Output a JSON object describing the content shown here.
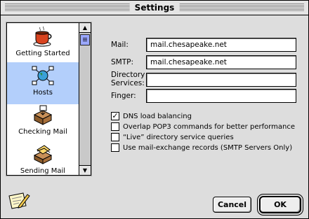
{
  "window": {
    "title": "Settings"
  },
  "sidebar": {
    "items": [
      {
        "label": "Getting Started",
        "icon": "coffee-cup-icon",
        "selected": false
      },
      {
        "label": "Hosts",
        "icon": "network-globe-icon",
        "selected": true
      },
      {
        "label": "Checking Mail",
        "icon": "mailbox-tray-icon",
        "selected": false
      },
      {
        "label": "Sending Mail",
        "icon": "outbox-letters-icon",
        "selected": false
      }
    ]
  },
  "form": {
    "mail_label": "Mail:",
    "mail_value": "mail.chesapeake.net",
    "smtp_label": "SMTP:",
    "smtp_value": "mail.chesapeake.net",
    "directory_label_line1": "Directory",
    "directory_label_line2": "Services:",
    "directory_value": "",
    "finger_label": "Finger:",
    "finger_value": ""
  },
  "options": [
    {
      "label": "DNS load balancing",
      "checked": true
    },
    {
      "label": "Overlap POP3 commands for better performance",
      "checked": false
    },
    {
      "label": "“Live” directory service queries",
      "checked": false
    },
    {
      "label": "Use mail-exchange records (SMTP Servers Only)",
      "checked": false
    }
  ],
  "buttons": {
    "cancel": "Cancel",
    "ok": "OK"
  },
  "colors": {
    "selection": "#b3cffb",
    "window_bg": "#dddddd"
  }
}
